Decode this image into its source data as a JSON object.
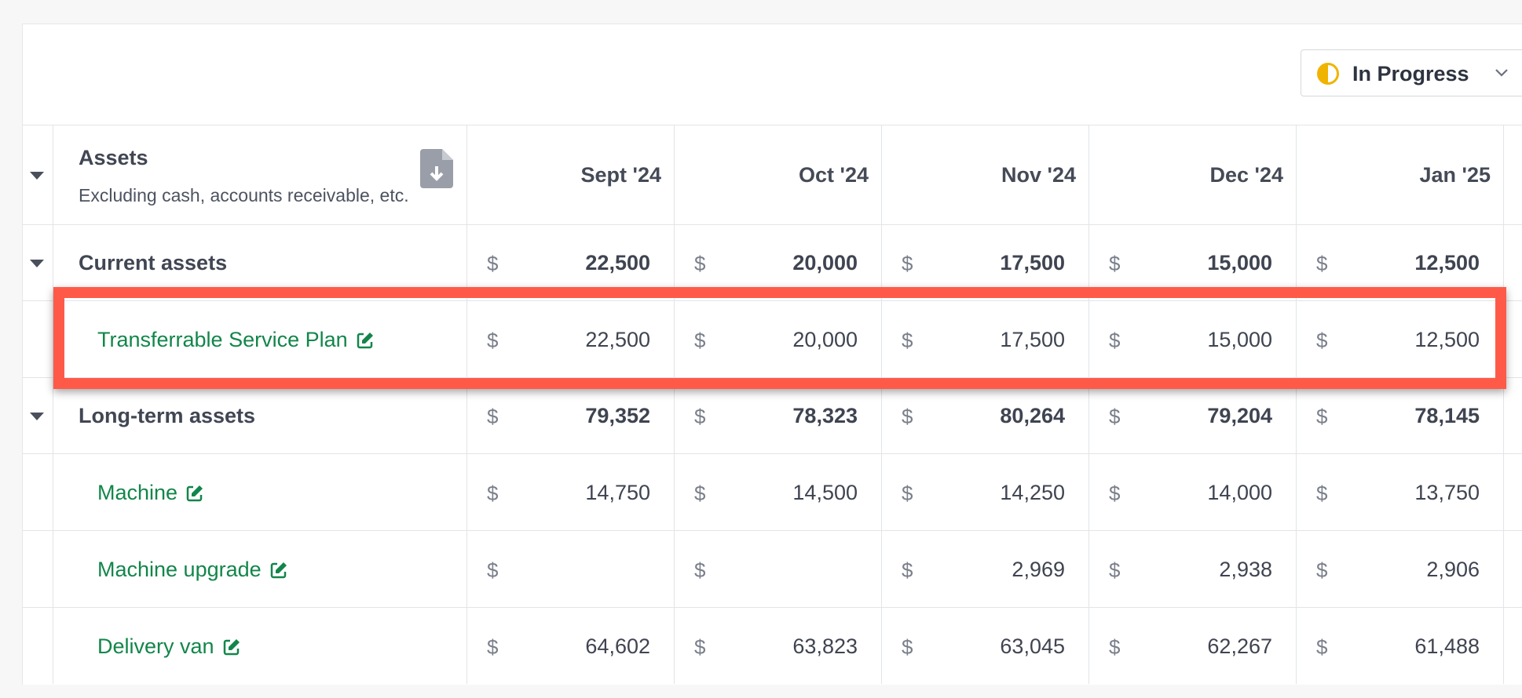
{
  "status": {
    "label": "In Progress",
    "accent": "#f0b400"
  },
  "table": {
    "title": "Assets",
    "subtitle": "Excluding cash, accounts receivable, etc.",
    "currency": "$",
    "columns": [
      "Sept '24",
      "Oct '24",
      "Nov '24",
      "Dec '24",
      "Jan '25"
    ],
    "rows": [
      {
        "label": "Current assets",
        "type": "group",
        "values": [
          "22,500",
          "20,000",
          "17,500",
          "15,000",
          "12,500"
        ]
      },
      {
        "label": "Transferrable Service Plan",
        "type": "item",
        "values": [
          "22,500",
          "20,000",
          "17,500",
          "15,000",
          "12,500"
        ]
      },
      {
        "label": "Long-term assets",
        "type": "group",
        "values": [
          "79,352",
          "78,323",
          "80,264",
          "79,204",
          "78,145"
        ]
      },
      {
        "label": "Machine",
        "type": "item",
        "values": [
          "14,750",
          "14,500",
          "14,250",
          "14,000",
          "13,750"
        ]
      },
      {
        "label": "Machine upgrade",
        "type": "item",
        "values": [
          "",
          "",
          "2,969",
          "2,938",
          "2,906"
        ]
      },
      {
        "label": "Delivery van",
        "type": "item",
        "values": [
          "64,602",
          "63,823",
          "63,045",
          "62,267",
          "61,488"
        ]
      }
    ]
  },
  "colors": {
    "link_green": "#12864a",
    "highlight_red": "#ff5a48",
    "text_dark": "#3f4451"
  }
}
